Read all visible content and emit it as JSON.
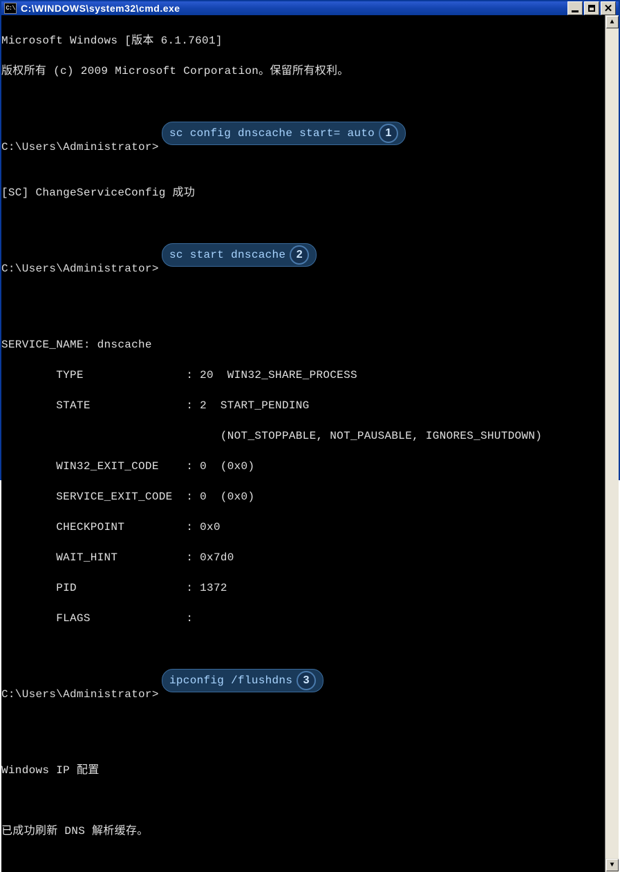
{
  "window": {
    "icon_label": "C:\\",
    "title": "C:\\WINDOWS\\system32\\cmd.exe"
  },
  "terminal": {
    "header_line": "Microsoft Windows [版本 6.1.7601]",
    "copyright_line": "版权所有 (c) 2009 Microsoft Corporation。保留所有权利。",
    "prompt": "C:\\Users\\Administrator>",
    "commands": {
      "cmd1": "sc config dnscache start= auto",
      "cmd1_response": "[SC] ChangeServiceConfig 成功",
      "cmd2": "sc start dnscache",
      "cmd3": "ipconfig /flushdns"
    },
    "service_output": {
      "service_name_label": "SERVICE_NAME: dnscache",
      "type_label": "        TYPE               : 20  WIN32_SHARE_PROCESS",
      "state_label": "        STATE              : 2  START_PENDING",
      "state_flags": "                                (NOT_STOPPABLE, NOT_PAUSABLE, IGNORES_SHUTDOWN)",
      "win32_exit": "        WIN32_EXIT_CODE    : 0  (0x0)",
      "service_exit": "        SERVICE_EXIT_CODE  : 0  (0x0)",
      "checkpoint": "        CHECKPOINT         : 0x0",
      "wait_hint": "        WAIT_HINT          : 0x7d0",
      "pid": "        PID                : 1372",
      "flags": "        FLAGS              :"
    },
    "ipconfig_output": {
      "header": "Windows IP 配置",
      "success": "已成功刷新 DNS 解析缓存。"
    }
  },
  "annotations": {
    "badge1": "1",
    "badge2": "2",
    "badge3": "3"
  }
}
